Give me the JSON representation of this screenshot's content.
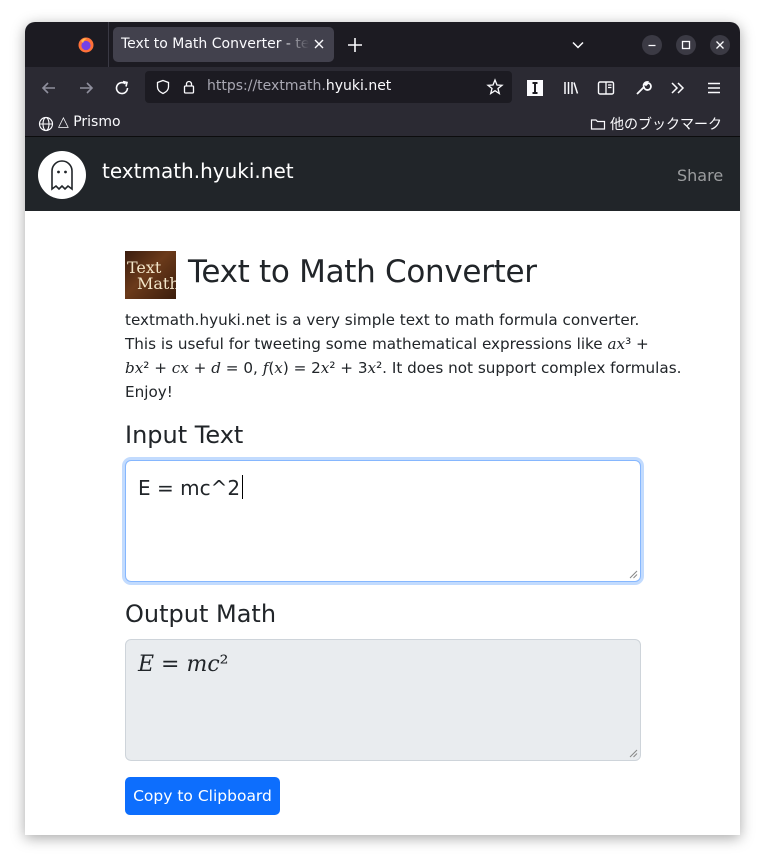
{
  "browser": {
    "tab_title": "Text to Math Converter - textmath.hyuki.net",
    "url_prefix": "https://textmath.",
    "url_host": "hyuki.net",
    "bookmark_left": "△ Prismo",
    "bookmark_right": "他のブックマーク"
  },
  "site_nav": {
    "brand": "textmath.hyuki.net",
    "share": "Share"
  },
  "page": {
    "title_image_line1": "Text",
    "title_image_line2": "Math",
    "title": "Text to Math Converter",
    "description_line1": "textmath.hyuki.net is a very simple text to math formula converter.",
    "description_line2_a": "This is useful for tweeting some mathematical expressions like ",
    "description_line2_math": "ax",
    "description_line2_b": "³ +",
    "description_line3_math1": "bx",
    "description_line3_a": "² + ",
    "description_line3_math2": "cx",
    "description_line3_b": " + ",
    "description_line3_math3": "d",
    "description_line3_c": " = 0, ",
    "description_line3_math4": "f",
    "description_line3_d": "(",
    "description_line3_math5": "x",
    "description_line3_e": ") = 2",
    "description_line3_math6": "x",
    "description_line3_f": "² + 3",
    "description_line3_math7": "x",
    "description_line3_g": "². It does not support complex formulas.",
    "description_line4": "Enjoy!",
    "input_heading": "Input Text",
    "input_value": "E = mc^2",
    "output_heading": "Output Math",
    "output_math_e": "E",
    "output_eq": " = ",
    "output_math_mc": "mc",
    "output_sup": "²",
    "copy_button": "Copy to Clipboard"
  },
  "colors": {
    "primary": "#0d6efd",
    "navbar": "#212529",
    "browser_chrome": "#2b2a33"
  }
}
